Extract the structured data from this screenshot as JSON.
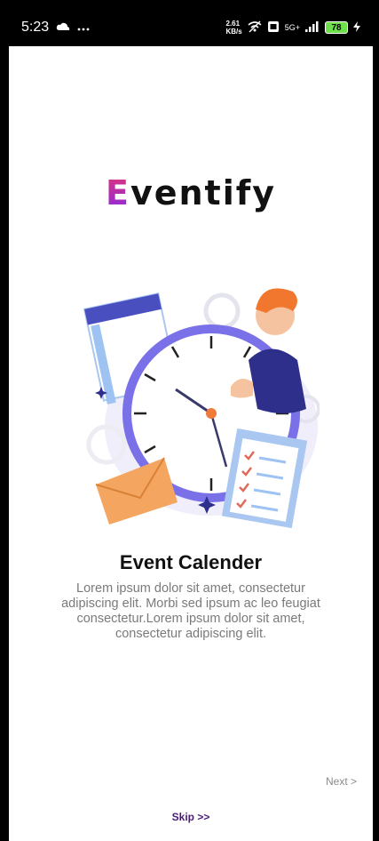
{
  "status_bar": {
    "time": "5:23",
    "speed_value": "2.61",
    "speed_unit": "KB/s",
    "network": "5G+",
    "battery": "78",
    "icons": [
      "cloud-icon",
      "more-dots-icon",
      "wifi-off-icon",
      "vo-lte-icon",
      "signal-icon",
      "battery-icon",
      "charging-icon"
    ]
  },
  "brand": {
    "logo_first_letter": "E",
    "logo_rest": "ventify",
    "accent_colors": [
      "#e0337a",
      "#8a2be2"
    ]
  },
  "onboarding": {
    "title": "Event Calender",
    "description": "Lorem ipsum dolor sit amet, consectetur adipiscing elit. Morbi sed ipsum ac leo feugiat consectetur.Lorem ipsum dolor sit amet, consectetur adipiscing elit.",
    "illustration": "clock-calendar-illustration"
  },
  "nav": {
    "next_label": "Next >",
    "skip_label": "Skip >>"
  }
}
